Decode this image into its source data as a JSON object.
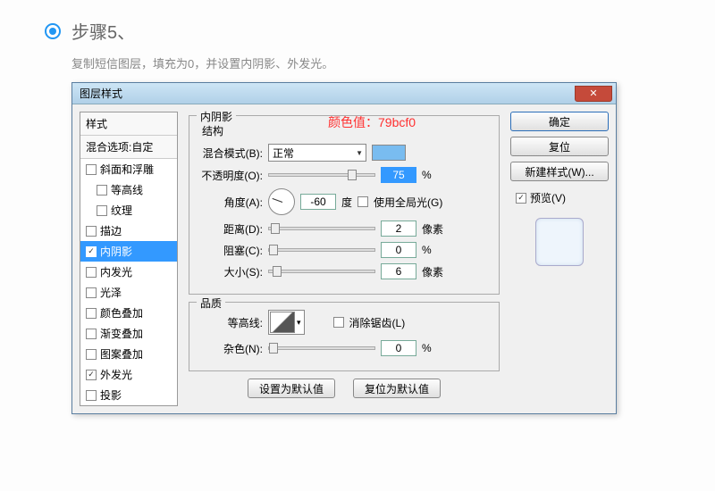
{
  "step": {
    "title": "步骤5、",
    "desc": "复制短信图层，填充为0，并设置内阴影、外发光。"
  },
  "dialog": {
    "title": "图层样式",
    "overlay": "颜色值：79bcf0",
    "sidebar": {
      "header": "样式",
      "subheader": "混合选项:自定",
      "items": [
        {
          "label": "斜面和浮雕",
          "checked": false,
          "indent": false
        },
        {
          "label": "等高线",
          "checked": false,
          "indent": true
        },
        {
          "label": "纹理",
          "checked": false,
          "indent": true
        },
        {
          "label": "描边",
          "checked": false,
          "indent": false
        },
        {
          "label": "内阴影",
          "checked": true,
          "indent": false,
          "selected": true
        },
        {
          "label": "内发光",
          "checked": false,
          "indent": false
        },
        {
          "label": "光泽",
          "checked": false,
          "indent": false
        },
        {
          "label": "颜色叠加",
          "checked": false,
          "indent": false
        },
        {
          "label": "渐变叠加",
          "checked": false,
          "indent": false
        },
        {
          "label": "图案叠加",
          "checked": false,
          "indent": false
        },
        {
          "label": "外发光",
          "checked": true,
          "indent": false
        },
        {
          "label": "投影",
          "checked": false,
          "indent": false
        }
      ]
    },
    "main": {
      "group1_title": "内阴影",
      "struct_title": "结构",
      "blend_label": "混合模式(B):",
      "blend_value": "正常",
      "swatch_color": "#79bcf0",
      "opacity_label": "不透明度(O):",
      "opacity_value": "75",
      "opacity_unit": "%",
      "angle_label": "角度(A):",
      "angle_value": "-60",
      "angle_unit": "度",
      "global_label": "使用全局光(G)",
      "distance_label": "距离(D):",
      "distance_value": "2",
      "px_unit": "像素",
      "choke_label": "阻塞(C):",
      "choke_value": "0",
      "choke_unit": "%",
      "size_label": "大小(S):",
      "size_value": "6",
      "quality_title": "品质",
      "contour_label": "等高线:",
      "antialias_label": "消除锯齿(L)",
      "noise_label": "杂色(N):",
      "noise_value": "0",
      "noise_unit": "%",
      "set_default": "设置为默认值",
      "reset_default": "复位为默认值"
    },
    "right": {
      "ok": "确定",
      "cancel": "复位",
      "new_style": "新建样式(W)...",
      "preview": "预览(V)"
    }
  }
}
